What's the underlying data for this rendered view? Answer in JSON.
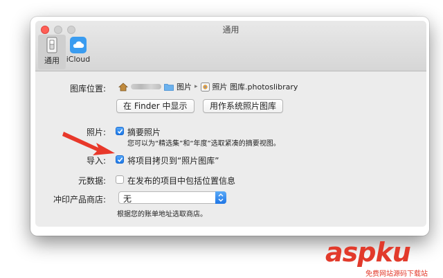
{
  "window": {
    "title": "通用"
  },
  "toolbar": {
    "items": [
      {
        "label": "通用",
        "icon": "general-switch-icon"
      },
      {
        "label": "iCloud",
        "icon": "icloud-icon"
      }
    ]
  },
  "library": {
    "label": "图库位置:",
    "path": {
      "folder": "图片",
      "library": "照片 图库.photoslibrary"
    },
    "finder_button": "在 Finder 中显示",
    "system_button": "用作系统照片图库"
  },
  "photos": {
    "label": "照片:",
    "summarize_label": "摘要照片",
    "summarize_checked": true,
    "summarize_desc": "您可以为“精选集”和“年度”选取紧凑的摘要视图。"
  },
  "import": {
    "label": "导入:",
    "copy_label": "将项目拷贝到“照片图库”",
    "copy_checked": true
  },
  "metadata": {
    "label": "元数据:",
    "location_label": "在发布的项目中包括位置信息",
    "location_checked": false
  },
  "print_store": {
    "label": "冲印产品商店:",
    "selected": "无",
    "desc": "根据您的账单地址选取商店。"
  },
  "watermark": {
    "text": "aspku",
    "sub": "免费网站源码下载站"
  },
  "colors": {
    "accent": "#1e78e6",
    "close": "#ff5f56",
    "arrow": "#e8382a"
  }
}
